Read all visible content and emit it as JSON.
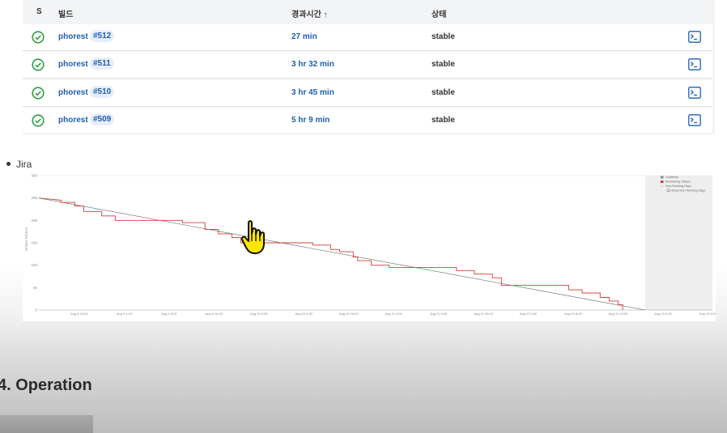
{
  "builds": {
    "headers": {
      "status": "S",
      "build": "빌드",
      "duration": "경과시간 ↑",
      "state": "상태"
    },
    "rows": [
      {
        "job": "phorest",
        "number": "#512",
        "duration": "27 min",
        "state": "stable"
      },
      {
        "job": "phorest",
        "number": "#511",
        "duration": "3 hr 32 min",
        "state": "stable"
      },
      {
        "job": "phorest",
        "number": "#510",
        "duration": "3 hr 45 min",
        "state": "stable"
      },
      {
        "job": "phorest",
        "number": "#509",
        "duration": "5 hr 9 min",
        "state": "stable"
      }
    ],
    "status_color": "#2e9e44",
    "link_color": "#1d5fb1"
  },
  "jira": {
    "bullet_label": "Jira"
  },
  "chart_data": {
    "type": "line",
    "ylabel": "STORY POINTS",
    "ylim": [
      0,
      300
    ],
    "y_ticks": [
      "300",
      "250",
      "200",
      "150",
      "100",
      "50",
      "0"
    ],
    "x_ticks": [
      "Aug 8 16:00",
      "Aug 9 0:00",
      "Aug 9 8:00",
      "Aug 9 16:00",
      "Aug 10 0:00",
      "Aug 10 8:00",
      "Aug 10 16:00",
      "Aug 11 0:00",
      "Aug 11 8:00",
      "Aug 11 16:00",
      "Aug 12 0:00",
      "Aug 12 8:00",
      "Aug 12 16:00",
      "Aug 13 0:00",
      "Aug 13 8:00"
    ],
    "legend": {
      "position": "top-right",
      "items": [
        "Guideline",
        "Remaining Values",
        "Non-Working Days"
      ],
      "checkbox_label": "Show Non-Working Days",
      "checkbox_checked": true
    },
    "series": [
      {
        "name": "Guideline",
        "color": "#7a7a7a",
        "points": [
          [
            0,
            250
          ],
          [
            13.5,
            0
          ]
        ]
      },
      {
        "name": "Remaining Values",
        "color": "#d23c3c",
        "points": [
          [
            0,
            250
          ],
          [
            0.5,
            245
          ],
          [
            0.5,
            240
          ],
          [
            0.8,
            240
          ],
          [
            0.8,
            232
          ],
          [
            1.0,
            232
          ],
          [
            1.0,
            220
          ],
          [
            1.4,
            220
          ],
          [
            1.4,
            210
          ],
          [
            1.7,
            210
          ],
          [
            1.7,
            200
          ],
          [
            3.2,
            200
          ],
          [
            3.2,
            195
          ],
          [
            3.7,
            195
          ],
          [
            3.7,
            180
          ],
          [
            4.0,
            180
          ],
          [
            4.0,
            170
          ],
          [
            4.3,
            170
          ],
          [
            4.3,
            162
          ],
          [
            4.5,
            162
          ],
          [
            4.5,
            150
          ],
          [
            6.1,
            150
          ],
          [
            6.1,
            145
          ],
          [
            6.5,
            145
          ],
          [
            6.5,
            135
          ],
          [
            6.7,
            135
          ],
          [
            6.7,
            130
          ],
          [
            7.0,
            130
          ],
          [
            7.0,
            118
          ],
          [
            7.1,
            118
          ],
          [
            7.1,
            110
          ],
          [
            7.4,
            110
          ],
          [
            7.4,
            100
          ],
          [
            7.8,
            100
          ],
          [
            7.8,
            95
          ],
          [
            9.3,
            95
          ],
          [
            9.3,
            88
          ],
          [
            9.7,
            88
          ],
          [
            9.7,
            80
          ],
          [
            10.1,
            80
          ],
          [
            10.1,
            72
          ],
          [
            10.3,
            72
          ],
          [
            10.3,
            55
          ],
          [
            11.8,
            55
          ],
          [
            11.8,
            45
          ],
          [
            12.1,
            45
          ],
          [
            12.1,
            38
          ],
          [
            12.5,
            38
          ],
          [
            12.5,
            28
          ],
          [
            12.7,
            28
          ],
          [
            12.7,
            20
          ],
          [
            12.9,
            20
          ],
          [
            12.9,
            12
          ],
          [
            13.0,
            12
          ],
          [
            13.0,
            0
          ]
        ]
      }
    ],
    "x_range": [
      0,
      15
    ],
    "non_working_start": 13.5
  },
  "section": {
    "heading": "4. Operation"
  }
}
